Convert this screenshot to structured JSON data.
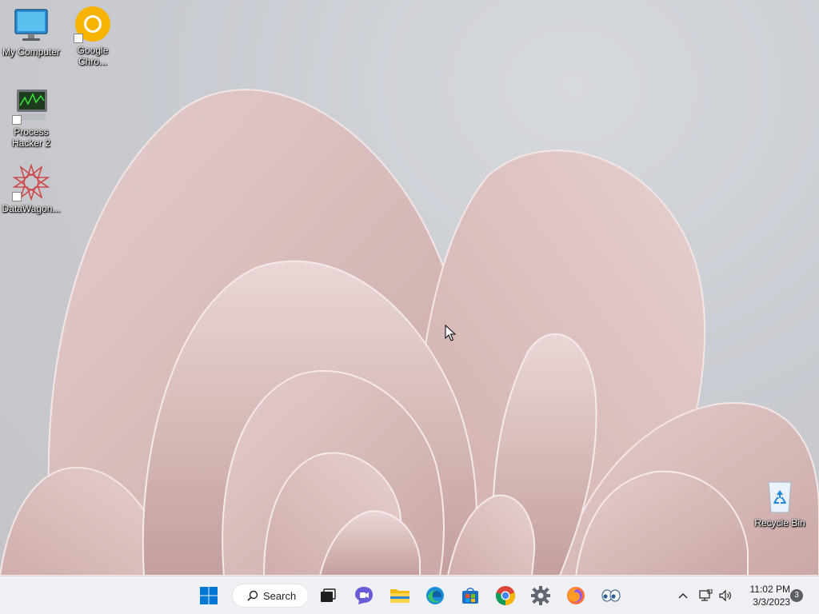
{
  "desktop": {
    "icons": [
      {
        "label": "My Computer",
        "icon": "monitor-icon"
      },
      {
        "label": "Google Chro...",
        "icon": "chrome-canary-icon"
      },
      {
        "label": "Process Hacker 2",
        "icon": "process-hacker-icon"
      },
      {
        "label": "DataWagon...",
        "icon": "datawagon-icon"
      },
      {
        "label": "Recycle Bin",
        "icon": "recycle-bin-icon"
      }
    ]
  },
  "taskbar": {
    "search": {
      "label": "Search",
      "icon": "search-icon"
    },
    "apps": [
      {
        "name": "start",
        "icon": "windows-logo-icon"
      },
      {
        "name": "task-view",
        "icon": "task-view-icon"
      },
      {
        "name": "teams-chat",
        "icon": "chat-icon"
      },
      {
        "name": "file-explorer",
        "icon": "folder-icon"
      },
      {
        "name": "edge",
        "icon": "edge-icon"
      },
      {
        "name": "microsoft-store",
        "icon": "store-icon"
      },
      {
        "name": "chrome",
        "icon": "chrome-icon"
      },
      {
        "name": "settings",
        "icon": "gear-icon"
      },
      {
        "name": "firefox",
        "icon": "firefox-icon"
      },
      {
        "name": "eyes-app",
        "icon": "eyes-icon"
      }
    ],
    "tray": {
      "time": "11:02 PM",
      "date": "3/3/2023",
      "notification_count": "3"
    }
  },
  "colors": {
    "wallpaper_bg": "#c9ccd2",
    "petal": "#d9bcbc",
    "taskbar_bg": "#eef0f4",
    "accent_blue": "#0078d4"
  }
}
